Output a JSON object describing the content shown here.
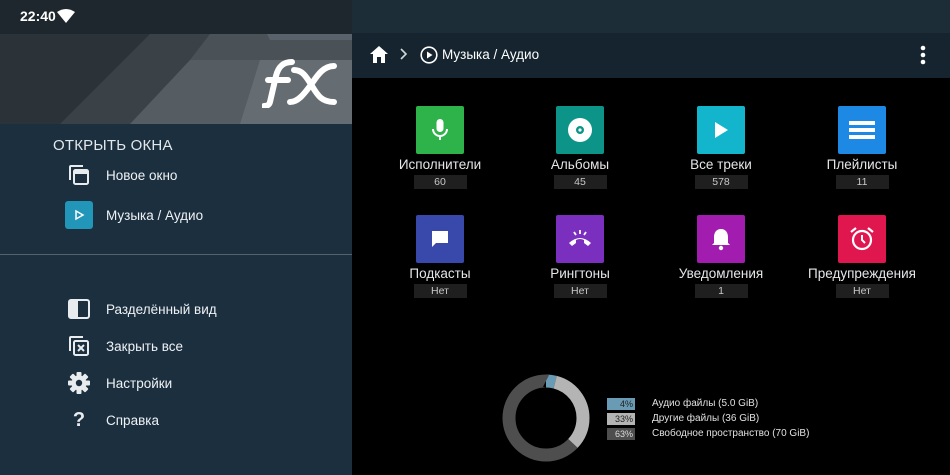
{
  "status": {
    "time": "22:40"
  },
  "drawer": {
    "section_title": "ОТКРЫТЬ ОКНА",
    "open_items": [
      {
        "label": "Новое окно",
        "icon": "new-window-icon"
      },
      {
        "label": "Музыка / Аудио",
        "icon": "play-icon"
      }
    ],
    "actions": [
      {
        "label": "Разделённый вид",
        "icon": "split-view-icon"
      },
      {
        "label": "Закрыть все",
        "icon": "close-all-icon"
      },
      {
        "label": "Настройки",
        "icon": "gear-icon"
      },
      {
        "label": "Справка",
        "icon": "help-icon"
      }
    ]
  },
  "toolbar": {
    "breadcrumb": "Музыка / Аудио"
  },
  "tiles": [
    {
      "label": "Исполнители",
      "count": "60",
      "color": "#2db34a",
      "icon": "microphone-icon"
    },
    {
      "label": "Альбомы",
      "count": "45",
      "color": "#0d9488",
      "icon": "disc-icon"
    },
    {
      "label": "Все треки",
      "count": "578",
      "color": "#12b5cb",
      "icon": "play-icon"
    },
    {
      "label": "Плейлисты",
      "count": "11",
      "color": "#1e88e5",
      "icon": "playlist-icon"
    },
    {
      "label": "Подкасты",
      "count": "Нет",
      "color": "#3949ab",
      "icon": "chat-icon"
    },
    {
      "label": "Рингтоны",
      "count": "Нет",
      "color": "#7b2fbe",
      "icon": "ringtone-icon"
    },
    {
      "label": "Уведомления",
      "count": "1",
      "color": "#a21caf",
      "icon": "bell-icon"
    },
    {
      "label": "Предупреждения",
      "count": "Нет",
      "color": "#e0164f",
      "icon": "alarm-icon"
    }
  ],
  "storage": [
    {
      "percent": "4%",
      "label": "Аудио файлы (5.0 GiB)",
      "color": "#6a9bb4",
      "fraction": 0.04
    },
    {
      "percent": "33%",
      "label": "Другие файлы (36 GiB)",
      "color": "#b4b4b4",
      "fraction": 0.33
    },
    {
      "percent": "63%",
      "label": "Свободное пространство (70 GiB)",
      "color": "#4e4e4e",
      "fraction": 0.63
    }
  ]
}
